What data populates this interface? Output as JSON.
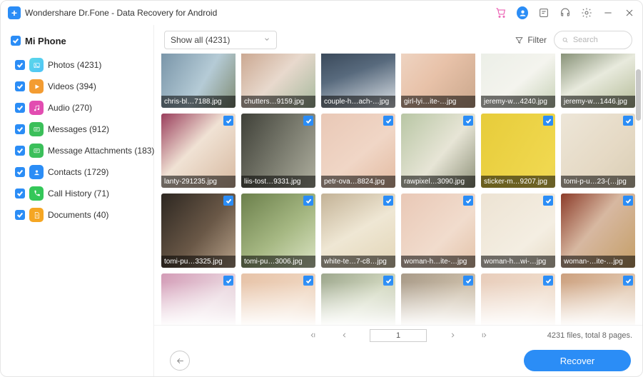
{
  "title": "Wondershare Dr.Fone - Data Recovery for Android",
  "device": {
    "name": "Mi Phone",
    "checked": true
  },
  "categories": [
    {
      "key": "photos",
      "label": "Photos (4231)",
      "icon": "photos"
    },
    {
      "key": "videos",
      "label": "Videos (394)",
      "icon": "videos"
    },
    {
      "key": "audio",
      "label": "Audio (270)",
      "icon": "audio"
    },
    {
      "key": "messages",
      "label": "Messages (912)",
      "icon": "messages"
    },
    {
      "key": "attach",
      "label": "Message Attachments (183)",
      "icon": "attach"
    },
    {
      "key": "contacts",
      "label": "Contacts (1729)",
      "icon": "contacts"
    },
    {
      "key": "callhist",
      "label": "Call History (71)",
      "icon": "callhist"
    },
    {
      "key": "docs",
      "label": "Documents (40)",
      "icon": "docs"
    }
  ],
  "toolbar": {
    "dropdown_label": "Show all (4231)",
    "filter_label": "Filter",
    "search_placeholder": "Search"
  },
  "thumbnails": [
    [
      {
        "caption": "chris-bl…7188.jpg",
        "g": "linear-gradient(120deg,#6e8ba0,#b5cbd6 60%,#818d75)"
      },
      {
        "caption": "chutters…9159.jpg",
        "g": "linear-gradient(135deg,#c2987e,#e8d9cd 55%,#a6b99d)"
      },
      {
        "caption": "couple-h…ach-…jpg",
        "g": "linear-gradient(160deg,#273444,#586a7d 50%,#dfe4e9)"
      },
      {
        "caption": "girl-lyi…ite-…jpg",
        "g": "linear-gradient(130deg,#f0d9c9,#e8c2a9 50%,#caa78c)"
      },
      {
        "caption": "jeremy-w…4240.jpg",
        "g": "linear-gradient(140deg,#e9ede5,#f4f4ee 60%,#c7d1b6)"
      },
      {
        "caption": "jeremy-w…1446.jpg",
        "g": "linear-gradient(150deg,#5c6a4a,#e8eadd 55%,#b5bc98)"
      }
    ],
    [
      {
        "caption": "lanty-291235.jpg",
        "g": "linear-gradient(135deg,#9a3e5c,#f0e2d4 45%,#d7b9a0)"
      },
      {
        "caption": "liis-tost…9331.jpg",
        "g": "linear-gradient(120deg,#3f4038,#7c7d70 55%,#aeae9e)"
      },
      {
        "caption": "petr-ova…8824.jpg",
        "g": "linear-gradient(140deg,#e9c8b6,#f0d6c6 55%,#e3bba1)"
      },
      {
        "caption": "rawpixel…3090.jpg",
        "g": "linear-gradient(130deg,#b8c6a4,#e7e5d6 55%,#8f927a)"
      },
      {
        "caption": "sticker-m…9207.jpg",
        "g": "linear-gradient(120deg,#e7cc3a,#f0d84f 85%,#e9d359)"
      },
      {
        "caption": "tomi-p-u…23-(…jpg",
        "g": "linear-gradient(135deg,#ede6d8,#e5d9c4 60%,#d9cdb4)"
      }
    ],
    [
      {
        "caption": "tomi-pu…3325.jpg",
        "g": "linear-gradient(130deg,#2d2721,#6a5847 55%,#b6a088)"
      },
      {
        "caption": "tomi-pu…3006.jpg",
        "g": "linear-gradient(140deg,#6b7f4b,#a6b883 55%,#dbe4c4)"
      },
      {
        "caption": "white-te…7-c8…jpg",
        "g": "linear-gradient(150deg,#c3b296,#efe7d4 50%,#e2d5b6)"
      },
      {
        "caption": "woman-h…ite-…jpg",
        "g": "linear-gradient(135deg,#e9c8b6,#f1dccd 60%,#e3c3a9)"
      },
      {
        "caption": "woman-h…wi-…jpg",
        "g": "linear-gradient(140deg,#ede3d3,#f4eee2 65%,#e7dcc7)"
      },
      {
        "caption": "woman-…ite-…jpg",
        "g": "linear-gradient(130deg,#8c3c2a,#d7b8a1 45%,#c59f67)"
      }
    ],
    [
      {
        "caption": "",
        "g": "linear-gradient(135deg,#d39bb6,#ead7df 55%,#d7bac7)"
      },
      {
        "caption": "",
        "g": "linear-gradient(130deg,#e7c3a8,#efd6c0 60%,#e0bd9d)"
      },
      {
        "caption": "",
        "g": "linear-gradient(140deg,#9da78d,#d3d9c1 50%,#b1b69b)"
      },
      {
        "caption": "",
        "g": "linear-gradient(135deg,#a89a88,#cdbfaa 55%,#c0ae93)"
      },
      {
        "caption": "",
        "g": "linear-gradient(130deg,#e8cdbb,#efdccb 60%,#e1c5ad)"
      },
      {
        "caption": "",
        "g": "linear-gradient(140deg,#cca07e,#e2c9b1 55%,#d4b597)"
      }
    ]
  ],
  "pager": {
    "page": "1",
    "info": "4231 files, total 8 pages."
  },
  "recover_label": "Recover"
}
